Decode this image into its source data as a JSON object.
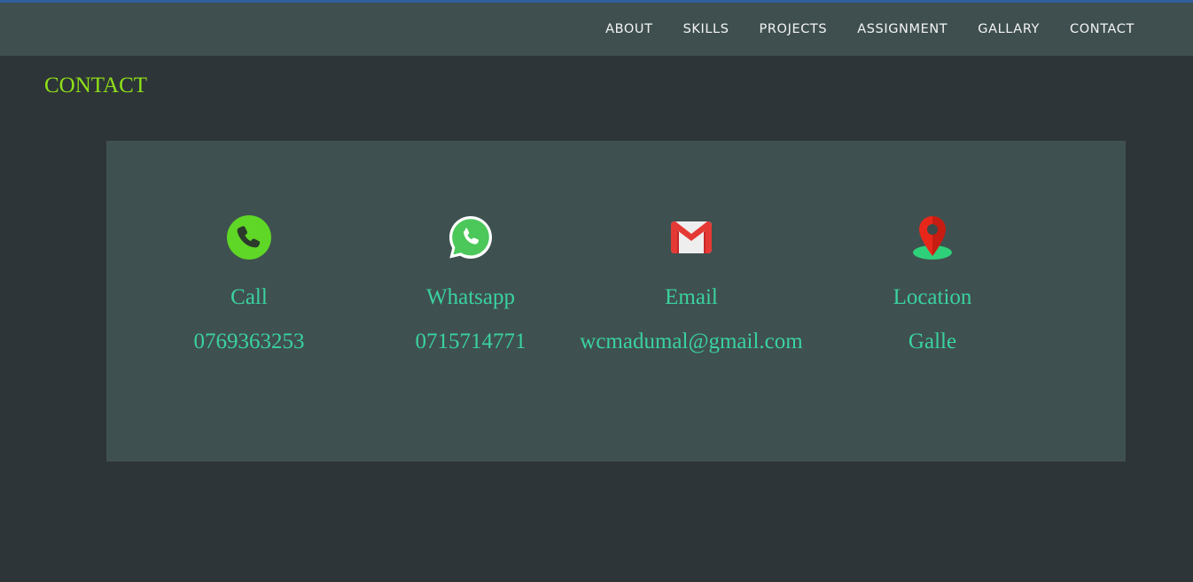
{
  "nav": {
    "items": [
      {
        "label": "ABOUT"
      },
      {
        "label": "SKILLS"
      },
      {
        "label": "PROJECTS"
      },
      {
        "label": "ASSIGNMENT"
      },
      {
        "label": "GALLARY"
      },
      {
        "label": "CONTACT"
      }
    ]
  },
  "page": {
    "title": "CONTACT"
  },
  "contacts": [
    {
      "label": "Call",
      "value": "0769363253",
      "icon": "phone-icon"
    },
    {
      "label": "Whatsapp",
      "value": "0715714771",
      "icon": "whatsapp-icon"
    },
    {
      "label": "Email",
      "value": "wcmadumal@gmail.com",
      "icon": "gmail-icon"
    },
    {
      "label": "Location",
      "value": "Galle",
      "icon": "location-pin-icon"
    }
  ],
  "colors": {
    "background": "#2d3538",
    "navbar": "#3f4f4f",
    "panel": "#3f5050",
    "title": "#8fe018",
    "contact_text": "#3ad29f",
    "nav_text": "#f4f4f4"
  }
}
